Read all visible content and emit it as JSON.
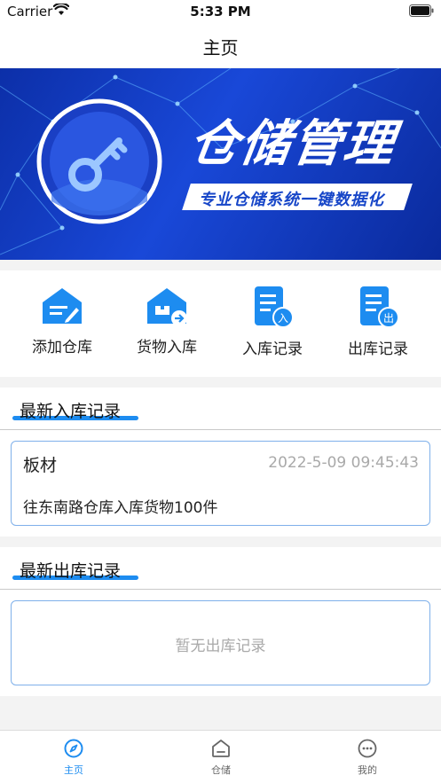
{
  "status_bar": {
    "carrier": "Carrier",
    "time": "5:33 PM"
  },
  "nav": {
    "title": "主页"
  },
  "banner": {
    "title": "仓储管理",
    "subtitle": "专业仓储系统一键数据化",
    "icon": "key-icon"
  },
  "menu": {
    "items": [
      {
        "label": "添加仓库",
        "icon": "add-warehouse-icon"
      },
      {
        "label": "货物入库",
        "icon": "goods-inbound-icon"
      },
      {
        "label": "入库记录",
        "icon": "inbound-records-icon"
      },
      {
        "label": "出库记录",
        "icon": "outbound-records-icon"
      }
    ]
  },
  "inbound": {
    "title": "最新入库记录",
    "record": {
      "name": "板材",
      "time": "2022-5-09 09:45:43",
      "description": "往东南路仓库入库货物100件"
    }
  },
  "outbound": {
    "title": "最新出库记录",
    "empty_text": "暂无出库记录"
  },
  "tabbar": {
    "items": [
      {
        "label": "主页",
        "icon": "compass-icon",
        "active": true
      },
      {
        "label": "仓储",
        "icon": "warehouse-icon",
        "active": false
      },
      {
        "label": "我的",
        "icon": "more-icon",
        "active": false
      }
    ]
  },
  "colors": {
    "accent": "#1d8cf0",
    "banner_blue": "#1746c8",
    "card_border": "#7fb0ea",
    "muted_text": "#a9a9a9"
  }
}
